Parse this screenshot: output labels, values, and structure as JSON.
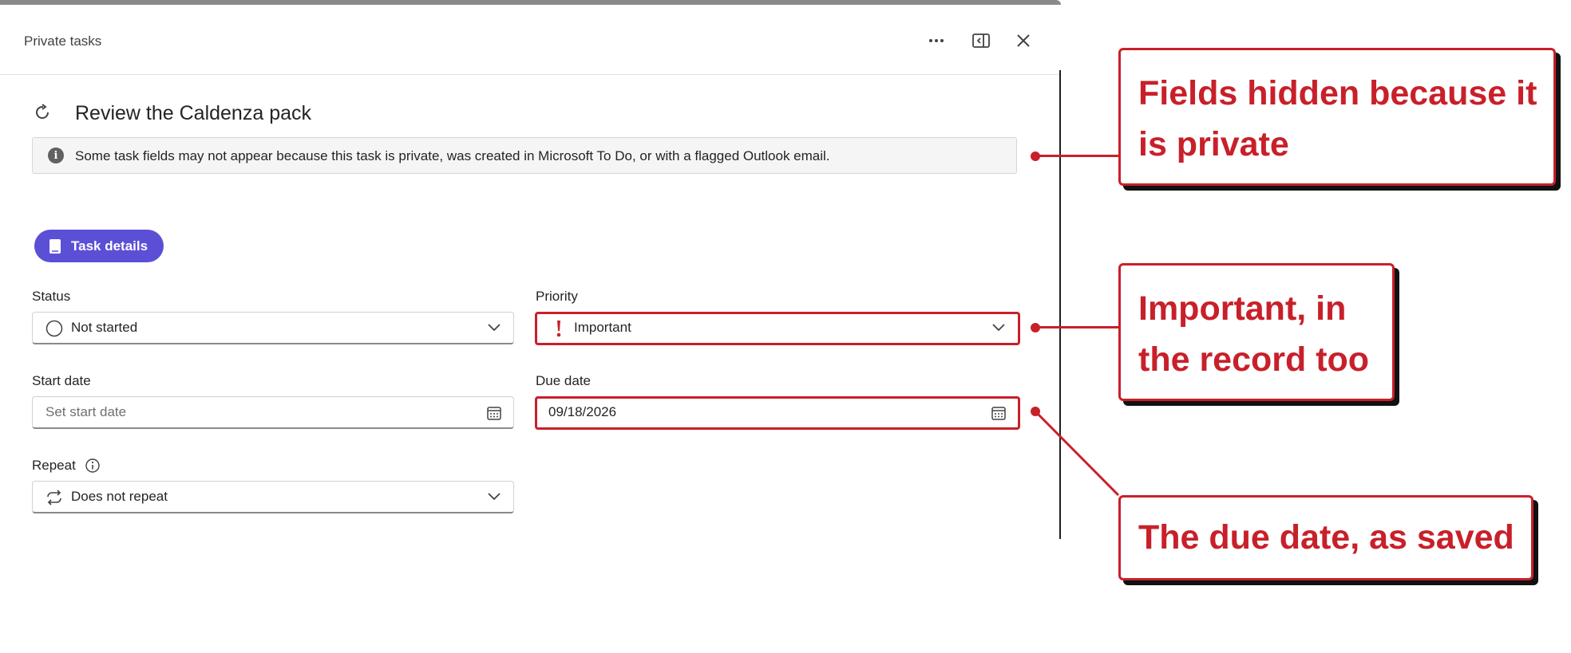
{
  "header": {
    "title": "Private tasks"
  },
  "task": {
    "title": "Review the Caldenza pack"
  },
  "info": {
    "text": "Some task fields may not appear because this task is private, was created in Microsoft To Do, or with a flagged Outlook email."
  },
  "tab": {
    "label": "Task details"
  },
  "status": {
    "label": "Status",
    "value": "Not started"
  },
  "priority": {
    "label": "Priority",
    "value": "Important"
  },
  "start_date": {
    "label": "Start date",
    "placeholder": "Set start date"
  },
  "due_date": {
    "label": "Due date",
    "value": "09/18/2026"
  },
  "repeat": {
    "label": "Repeat",
    "value": "Does not repeat"
  },
  "annotations": {
    "private": "Fields hidden because it is private",
    "important": "Important, in the record too",
    "due": "The due date, as saved"
  },
  "colors": {
    "accent": "#5b4fd6",
    "annotation": "#c8202a",
    "priority": "#c8202a"
  },
  "icons": {
    "more": "more-icon",
    "dock": "dock-panel-icon",
    "close": "close-icon",
    "refresh": "refresh-icon",
    "info": "info-icon",
    "calendar": "calendar-icon",
    "repeat": "repeat-icon"
  }
}
